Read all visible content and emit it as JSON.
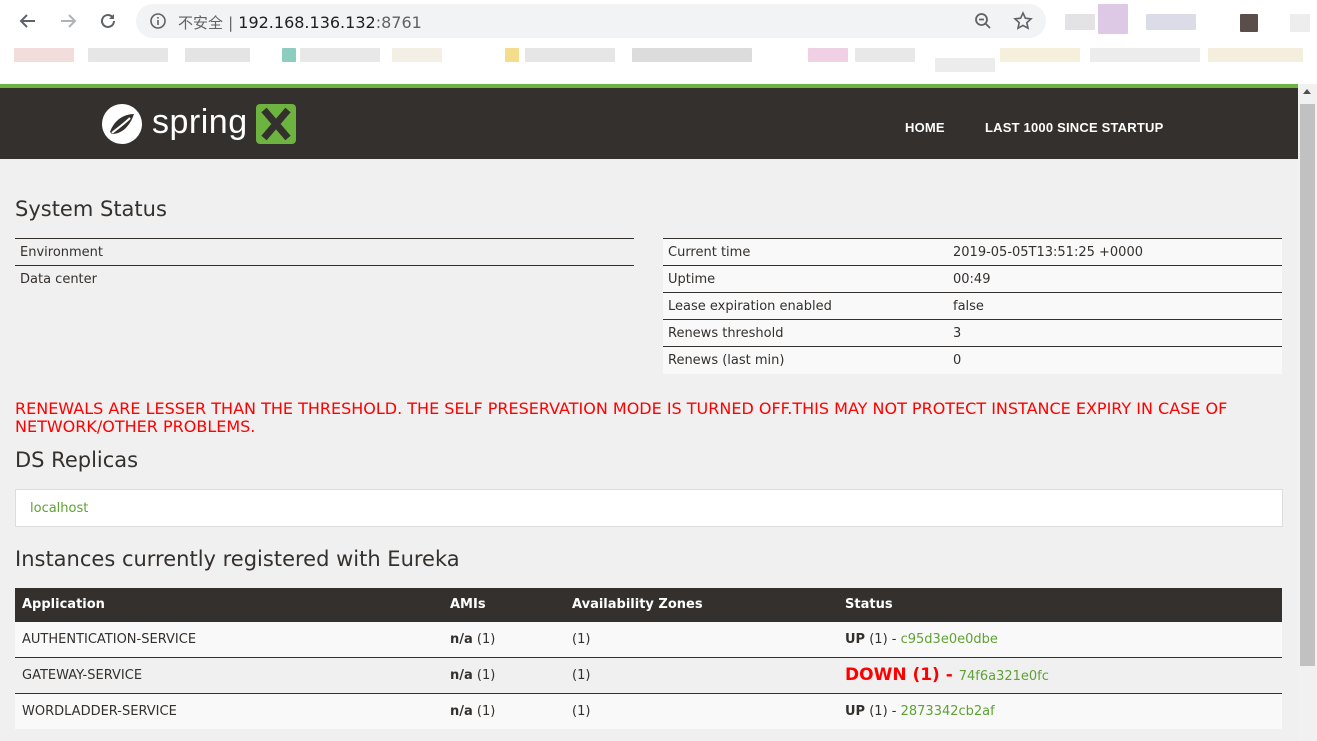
{
  "browser": {
    "back_icon": "arrow-left-icon",
    "forward_icon": "arrow-right-icon",
    "reload_icon": "reload-icon",
    "security_icon": "info-icon",
    "security_label": "不安全",
    "separator": "|",
    "url_host": "192.168.136.132",
    "url_port": ":8761",
    "zoom_icon": "zoom-out-icon",
    "bookmark_icon": "star-icon"
  },
  "navbar": {
    "logo_text": "spring",
    "logo_mark": "X",
    "home_label": "HOME",
    "last_label": "LAST 1000 SINCE STARTUP",
    "accent_color": "#6db33f",
    "bg_color": "#34302d"
  },
  "system_status": {
    "title": "System Status",
    "left": [
      {
        "label": "Environment",
        "value": ""
      },
      {
        "label": "Data center",
        "value": ""
      }
    ],
    "right": [
      {
        "label": "Current time",
        "value": "2019-05-05T13:51:25 +0000"
      },
      {
        "label": "Uptime",
        "value": "00:49"
      },
      {
        "label": "Lease expiration enabled",
        "value": "false"
      },
      {
        "label": "Renews threshold",
        "value": "3"
      },
      {
        "label": "Renews (last min)",
        "value": "0"
      }
    ]
  },
  "warning": "RENEWALS ARE LESSER THAN THE THRESHOLD. THE SELF PRESERVATION MODE IS TURNED OFF.THIS MAY NOT PROTECT INSTANCE EXPIRY IN CASE OF NETWORK/OTHER PROBLEMS.",
  "replicas": {
    "title": "DS Replicas",
    "items": [
      "localhost"
    ]
  },
  "instances": {
    "title": "Instances currently registered with Eureka",
    "headers": [
      "Application",
      "AMIs",
      "Availability Zones",
      "Status"
    ],
    "rows": [
      {
        "app": "AUTHENTICATION-SERVICE",
        "ami": "n/a",
        "ami_count": " (1)",
        "zones": "(1)",
        "status": "UP",
        "status_count": " (1) - ",
        "instance": "c95d3e0e0dbe"
      },
      {
        "app": "GATEWAY-SERVICE",
        "ami": "n/a",
        "ami_count": " (1)",
        "zones": "(1)",
        "status": "DOWN (1) - ",
        "status_count": "",
        "instance": "74f6a321e0fc"
      },
      {
        "app": "WORDLADDER-SERVICE",
        "ami": "n/a",
        "ami_count": " (1)",
        "zones": "(1)",
        "status": "UP",
        "status_count": " (1) - ",
        "instance": "2873342cb2af"
      }
    ]
  }
}
